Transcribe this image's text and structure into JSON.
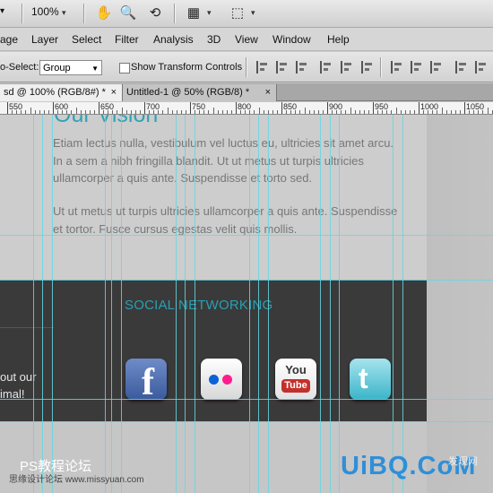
{
  "appbar": {
    "zoom_label": "100%",
    "icons": [
      "hand-tool-icon",
      "zoom-tool-icon",
      "rotate-view-icon",
      "arrange-documents-icon",
      "screen-mode-icon"
    ]
  },
  "menu": {
    "items": [
      "age",
      "Layer",
      "Select",
      "Filter",
      "Analysis",
      "3D",
      "View",
      "Window",
      "Help"
    ]
  },
  "options": {
    "auto_select_label": "o-Select:",
    "auto_select_value": "Group",
    "show_transform_label": "Show Transform Controls"
  },
  "tabs": {
    "active_label": "sd @ 100% (RGB/8#) *",
    "other_label": "Untitled-1 @ 50% (RGB/8) *",
    "close_glyph": "×"
  },
  "ruler": {
    "labels": [
      "550",
      "600",
      "650",
      "700",
      "750",
      "800",
      "850",
      "900",
      "950",
      "1000",
      "1050"
    ]
  },
  "document": {
    "heading_partial": "Our Vision",
    "paragraph1": "Etiam lectus nulla, vestibulum vel luctus eu, ultricies sit amet arcu. In a sem a nibh fringilla blandit. Ut ut metus ut turpis ultricies ullamcorper a quis ante. Suspendisse et torto sed.",
    "paragraph2": "Ut ut metus ut turpis ultricies ullamcorper a quis ante. Suspendisse et tortor. Fusce cursus egestas velit quis mollis.",
    "social_heading": "SOCIAL NETWORKING",
    "side_text_line1": "out our",
    "side_text_line2": "imal!",
    "social_icons": [
      "facebook-icon",
      "flickr-icon",
      "youtube-icon",
      "twitter-icon"
    ]
  },
  "watermarks": {
    "ps_forum": "PS教程论坛",
    "ps_sub": "思缘设计论坛 www.missyuan.com",
    "uibq": "UiBQ.CoM",
    "corner": "发现网"
  },
  "colors": {
    "accent_teal": "#2fa3b8",
    "guide": "#66d6e2",
    "dark_band": "#3a3a3a"
  }
}
